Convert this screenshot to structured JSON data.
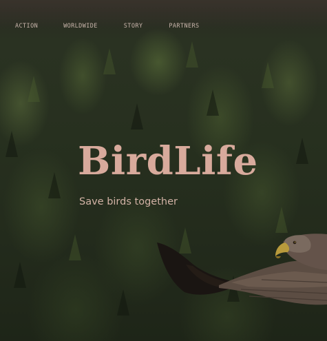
{
  "nav": {
    "items": [
      {
        "label": "ACTION"
      },
      {
        "label": "WORLDWIDE"
      },
      {
        "label": "STORY"
      },
      {
        "label": "PARTNERS"
      }
    ]
  },
  "hero": {
    "title": "BirdLife",
    "tagline": "Save birds together"
  },
  "colors": {
    "title": "#d8aa9c",
    "nav_text": "#c9b5ab",
    "forest": "#27301f"
  }
}
